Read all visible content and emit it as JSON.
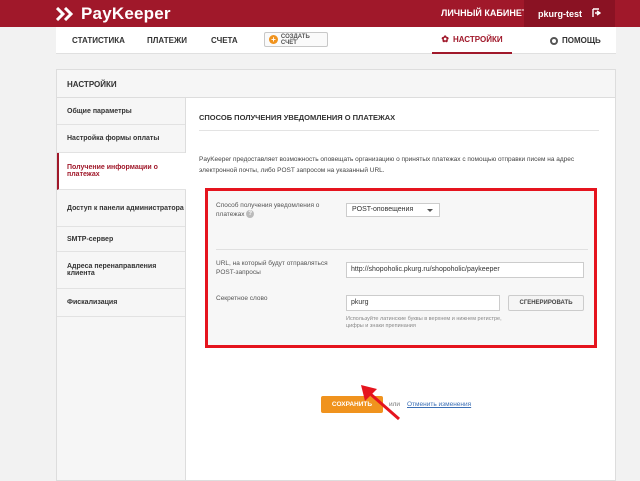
{
  "brand": {
    "logo_text": "PayKeeper",
    "accent": "#a0182a",
    "highlight": "#e5141e",
    "button_orange": "#f0931e"
  },
  "header": {
    "cabinet_label": "ЛИЧНЫЙ КАБИНЕТ:",
    "username": "pkurg-test",
    "logout_icon": "logout-icon"
  },
  "nav": {
    "items": [
      "СТАТИСТИКА",
      "ПЛАТЕЖИ",
      "СЧЕТА"
    ],
    "create_invoice": "СОЗДАТЬ СЧЁТ",
    "settings": "НАСТРОЙКИ",
    "help": "ПОМОЩЬ"
  },
  "card": {
    "title": "НАСТРОЙКИ"
  },
  "sidebar": {
    "items": [
      {
        "label": "Общие параметры",
        "active": false
      },
      {
        "label": "Настройка формы оплаты",
        "active": false
      },
      {
        "label": "Получение информации о платежах",
        "active": true
      },
      {
        "label": "Доступ к панели администратора",
        "active": false
      },
      {
        "label": "SMTP-сервер",
        "active": false
      },
      {
        "label": "Адреса перенаправления клиента",
        "active": false
      },
      {
        "label": "Фискализация",
        "active": false
      }
    ]
  },
  "content": {
    "section_title": "СПОСОБ ПОЛУЧЕНИЯ УВЕДОМЛЕНИЯ О ПЛАТЕЖАХ",
    "description": "PayKeeper предоставляет возможность оповещать организацию о принятых платежах с помощью отправки писем на адрес электронной почты, либо POST запросом на указанный URL.",
    "form": {
      "method_label": "Способ получения уведомления о платежах",
      "method_value": "POST-оповещения",
      "url_label": "URL, на который будут отправляться POST-запросы",
      "url_value": "http://shopoholic.pkurg.ru/shopoholic/paykeeper",
      "secret_label": "Секретное слово",
      "secret_value": "pkurg",
      "generate_button": "СГЕНЕРИРОВАТЬ",
      "hint": "Используйте латинские буквы в верхнем и нижнем регистре, цифры и знаки препинания"
    },
    "save_button": "СОХРАНИТЬ",
    "or_text": "или",
    "cancel_link": "Отменить изменения"
  }
}
